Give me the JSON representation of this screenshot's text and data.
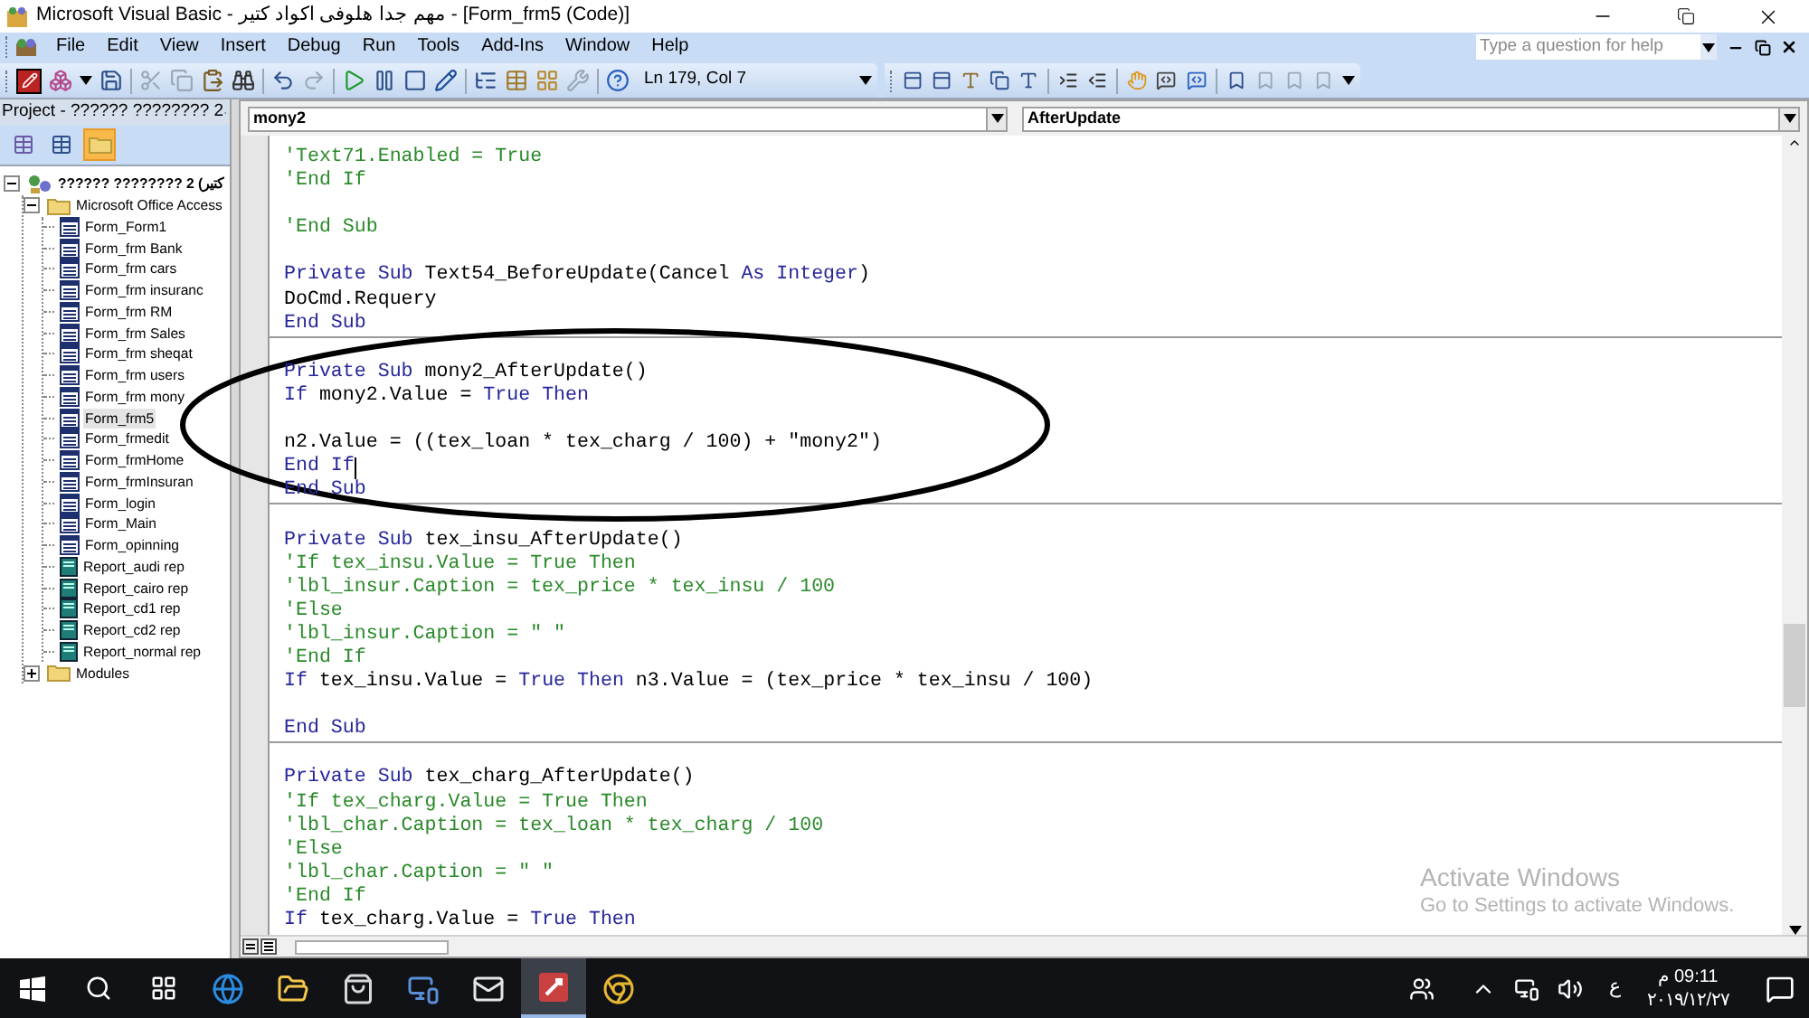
{
  "window": {
    "title": "Microsoft Visual Basic - مهم جدا هلوفى اكواد كتير - [Form_frm5 (Code)]"
  },
  "menu": [
    {
      "label": "File"
    },
    {
      "label": "Edit"
    },
    {
      "label": "View"
    },
    {
      "label": "Insert"
    },
    {
      "label": "Debug"
    },
    {
      "label": "Run"
    },
    {
      "label": "Tools"
    },
    {
      "label": "Add-Ins"
    },
    {
      "label": "Window"
    },
    {
      "label": "Help"
    }
  ],
  "help_box": {
    "placeholder": "Type a question for help"
  },
  "toolbar": {
    "position": "Ln 179, Col 7"
  },
  "project": {
    "title": "Project - ?????? ???????? 2",
    "view_buttons": [
      {
        "kind": "object",
        "on": false
      },
      {
        "kind": "code",
        "on": false
      },
      {
        "kind": "folders",
        "on": true
      }
    ],
    "tree": [
      {
        "label": "?????? ???????? 2 (كتير",
        "kind": "project",
        "expanded": true,
        "children": [
          {
            "label": "Microsoft Office Access",
            "kind": "folder",
            "expanded": true,
            "children": [
              {
                "label": "Form_Form1",
                "kind": "form",
                "selected": false
              },
              {
                "label": "Form_frm Bank",
                "kind": "form",
                "selected": false
              },
              {
                "label": "Form_frm cars",
                "kind": "form",
                "selected": false
              },
              {
                "label": "Form_frm insuranc",
                "kind": "form",
                "selected": false
              },
              {
                "label": "Form_frm RM",
                "kind": "form",
                "selected": false
              },
              {
                "label": "Form_frm Sales",
                "kind": "form",
                "selected": false
              },
              {
                "label": "Form_frm sheqat",
                "kind": "form",
                "selected": false
              },
              {
                "label": "Form_frm users",
                "kind": "form",
                "selected": false
              },
              {
                "label": "Form_frm mony",
                "kind": "form",
                "selected": false
              },
              {
                "label": "Form_frm5",
                "kind": "form",
                "selected": true
              },
              {
                "label": "Form_frmedit",
                "kind": "form",
                "selected": false
              },
              {
                "label": "Form_frmHome",
                "kind": "form",
                "selected": false
              },
              {
                "label": "Form_frmInsuran",
                "kind": "form",
                "selected": false
              },
              {
                "label": "Form_login",
                "kind": "form",
                "selected": false
              },
              {
                "label": "Form_Main",
                "kind": "form",
                "selected": false
              },
              {
                "label": "Form_opinning",
                "kind": "form",
                "selected": false
              },
              {
                "label": "Report_audi rep",
                "kind": "report",
                "selected": false
              },
              {
                "label": "Report_cairo rep",
                "kind": "report",
                "selected": false
              },
              {
                "label": "Report_cd1 rep",
                "kind": "report",
                "selected": false
              },
              {
                "label": "Report_cd2 rep",
                "kind": "report",
                "selected": false
              },
              {
                "label": "Report_normal rep",
                "kind": "report",
                "selected": false
              }
            ]
          },
          {
            "label": "Modules",
            "kind": "folder",
            "expanded": false
          }
        ]
      }
    ]
  },
  "code_window": {
    "object": "mony2",
    "procedure": "AfterUpdate",
    "blocks": [
      {
        "lines": [
          {
            "kind": "comment",
            "text": "'Text71.Enabled = True"
          },
          {
            "kind": "comment",
            "text": "'End If"
          },
          {
            "kind": "blank"
          },
          {
            "kind": "comment",
            "text": "'End Sub"
          },
          {
            "kind": "blank"
          },
          {
            "kind": "code",
            "segments": [
              {
                "kind": "keyword",
                "text": "Private Sub"
              },
              {
                "kind": "plain",
                "text": " Text54_BeforeUpdate(Cancel "
              },
              {
                "kind": "keyword",
                "text": "As Integer"
              },
              {
                "kind": "plain",
                "text": ")"
              }
            ]
          },
          {
            "kind": "code",
            "segments": [
              {
                "kind": "plain",
                "text": "DoCmd.Requery"
              }
            ]
          },
          {
            "kind": "code",
            "segments": [
              {
                "kind": "keyword",
                "text": "End Sub"
              }
            ]
          }
        ]
      },
      {
        "lines": [
          {
            "kind": "blank"
          },
          {
            "kind": "code",
            "segments": [
              {
                "kind": "keyword",
                "text": "Private Sub"
              },
              {
                "kind": "plain",
                "text": " mony2_AfterUpdate()"
              }
            ]
          },
          {
            "kind": "code",
            "segments": [
              {
                "kind": "keyword",
                "text": "If"
              },
              {
                "kind": "plain",
                "text": " mony2.Value = "
              },
              {
                "kind": "keyword",
                "text": "True Then"
              }
            ]
          },
          {
            "kind": "blank"
          },
          {
            "kind": "code",
            "segments": [
              {
                "kind": "plain",
                "text": "n2.Value = ((tex_loan * tex_charg / 100) + \"mony2\")"
              }
            ]
          },
          {
            "kind": "code",
            "cursor": true,
            "segments": [
              {
                "kind": "keyword",
                "text": "End If"
              }
            ]
          },
          {
            "kind": "code",
            "segments": [
              {
                "kind": "keyword",
                "text": "End Sub"
              }
            ]
          }
        ]
      },
      {
        "lines": [
          {
            "kind": "blank"
          },
          {
            "kind": "code",
            "segments": [
              {
                "kind": "keyword",
                "text": "Private Sub"
              },
              {
                "kind": "plain",
                "text": " tex_insu_AfterUpdate()"
              }
            ]
          },
          {
            "kind": "comment",
            "text": "'If tex_insu.Value = True Then"
          },
          {
            "kind": "comment",
            "text": "'lbl_insur.Caption = tex_price * tex_insu / 100"
          },
          {
            "kind": "comment",
            "text": "'Else"
          },
          {
            "kind": "comment",
            "text": "'lbl_insur.Caption = \" \""
          },
          {
            "kind": "comment",
            "text": "'End If"
          },
          {
            "kind": "code",
            "segments": [
              {
                "kind": "keyword",
                "text": "If"
              },
              {
                "kind": "plain",
                "text": " tex_insu.Value = "
              },
              {
                "kind": "keyword",
                "text": "True Then"
              },
              {
                "kind": "plain",
                "text": " n3.Value = (tex_price * tex_insu / 100)"
              }
            ]
          },
          {
            "kind": "blank"
          },
          {
            "kind": "code",
            "segments": [
              {
                "kind": "keyword",
                "text": "End Sub"
              }
            ]
          }
        ]
      },
      {
        "lines": [
          {
            "kind": "blank"
          },
          {
            "kind": "code",
            "segments": [
              {
                "kind": "keyword",
                "text": "Private Sub"
              },
              {
                "kind": "plain",
                "text": " tex_charg_AfterUpdate()"
              }
            ]
          },
          {
            "kind": "comment",
            "text": "'If tex_charg.Value = True Then"
          },
          {
            "kind": "comment",
            "text": "'lbl_char.Caption = tex_loan * tex_charg / 100"
          },
          {
            "kind": "comment",
            "text": "'Else"
          },
          {
            "kind": "comment",
            "text": "'lbl_char.Caption = \" \""
          },
          {
            "kind": "comment",
            "text": "'End If"
          },
          {
            "kind": "code",
            "segments": [
              {
                "kind": "keyword",
                "text": "If"
              },
              {
                "kind": "plain",
                "text": " tex_charg.Value = "
              },
              {
                "kind": "keyword",
                "text": "True Then"
              }
            ]
          }
        ]
      }
    ]
  },
  "activation_notice": {
    "title": "Activate Windows",
    "text": "Go to Settings to activate Windows."
  },
  "taskbar": {
    "apps": [
      {
        "kind": "edge",
        "active": false
      },
      {
        "kind": "explorer",
        "active": false
      },
      {
        "kind": "store",
        "active": false
      },
      {
        "kind": "network-app",
        "active": false
      },
      {
        "kind": "mail",
        "active": false
      },
      {
        "kind": "access",
        "active": true
      },
      {
        "kind": "chrome",
        "active": false
      }
    ],
    "language": "ع",
    "time": "09:11 م",
    "date": "٢٠١٩/١٢/٢٧"
  }
}
